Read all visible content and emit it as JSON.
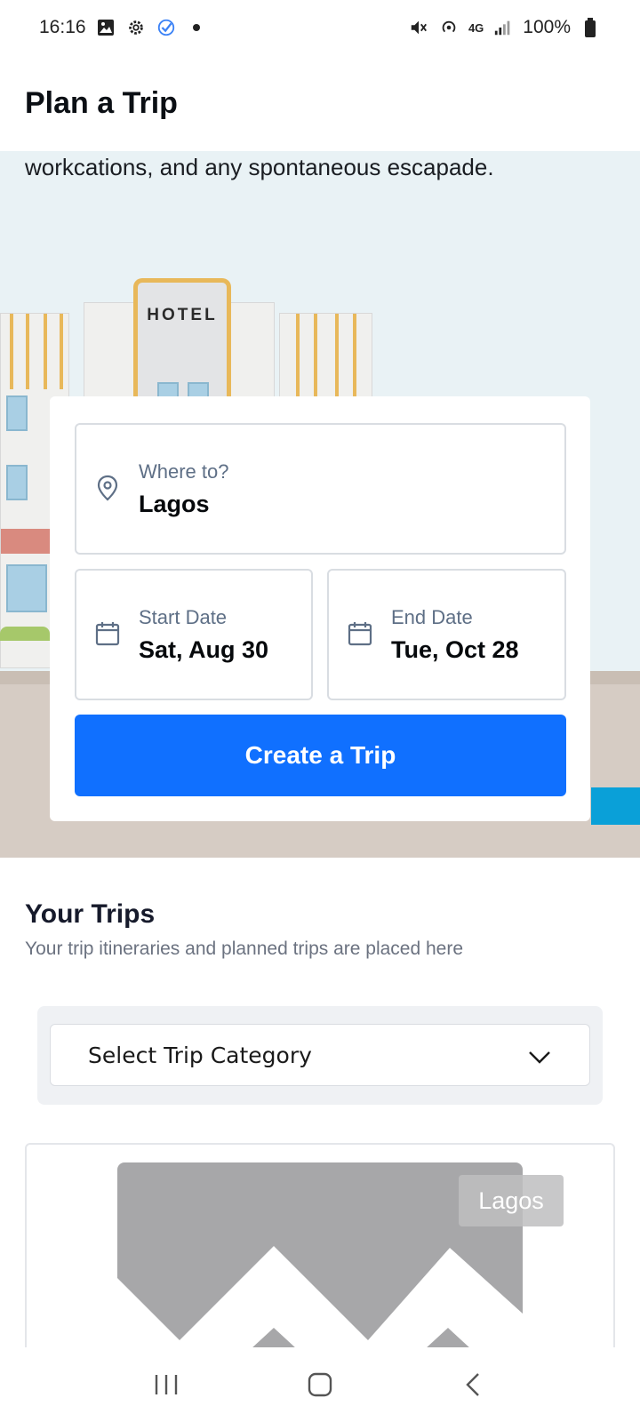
{
  "status_bar": {
    "time": "16:16",
    "battery": "100%",
    "network": "4G"
  },
  "header": {
    "title": "Plan a Trip"
  },
  "hero": {
    "text": "workcations, and any spontaneous escapade.",
    "hotel_sign": "HOTEL"
  },
  "search": {
    "destination_label": "Where to?",
    "destination_value": "Lagos",
    "start_label": "Start Date",
    "start_value": "Sat, Aug 30",
    "end_label": "End Date",
    "end_value": "Tue, Oct 28",
    "create_button": "Create a Trip"
  },
  "trips": {
    "title": "Your Trips",
    "subtitle": "Your trip itineraries and planned trips are placed here",
    "category_select": "Select Trip Category",
    "items": [
      {
        "place": "Lagos"
      }
    ]
  },
  "colors": {
    "primary": "#1070ff",
    "hero_bg": "#e9f2f5",
    "ground": "#d6ccc4",
    "hotel_accent": "#e8b85a"
  }
}
